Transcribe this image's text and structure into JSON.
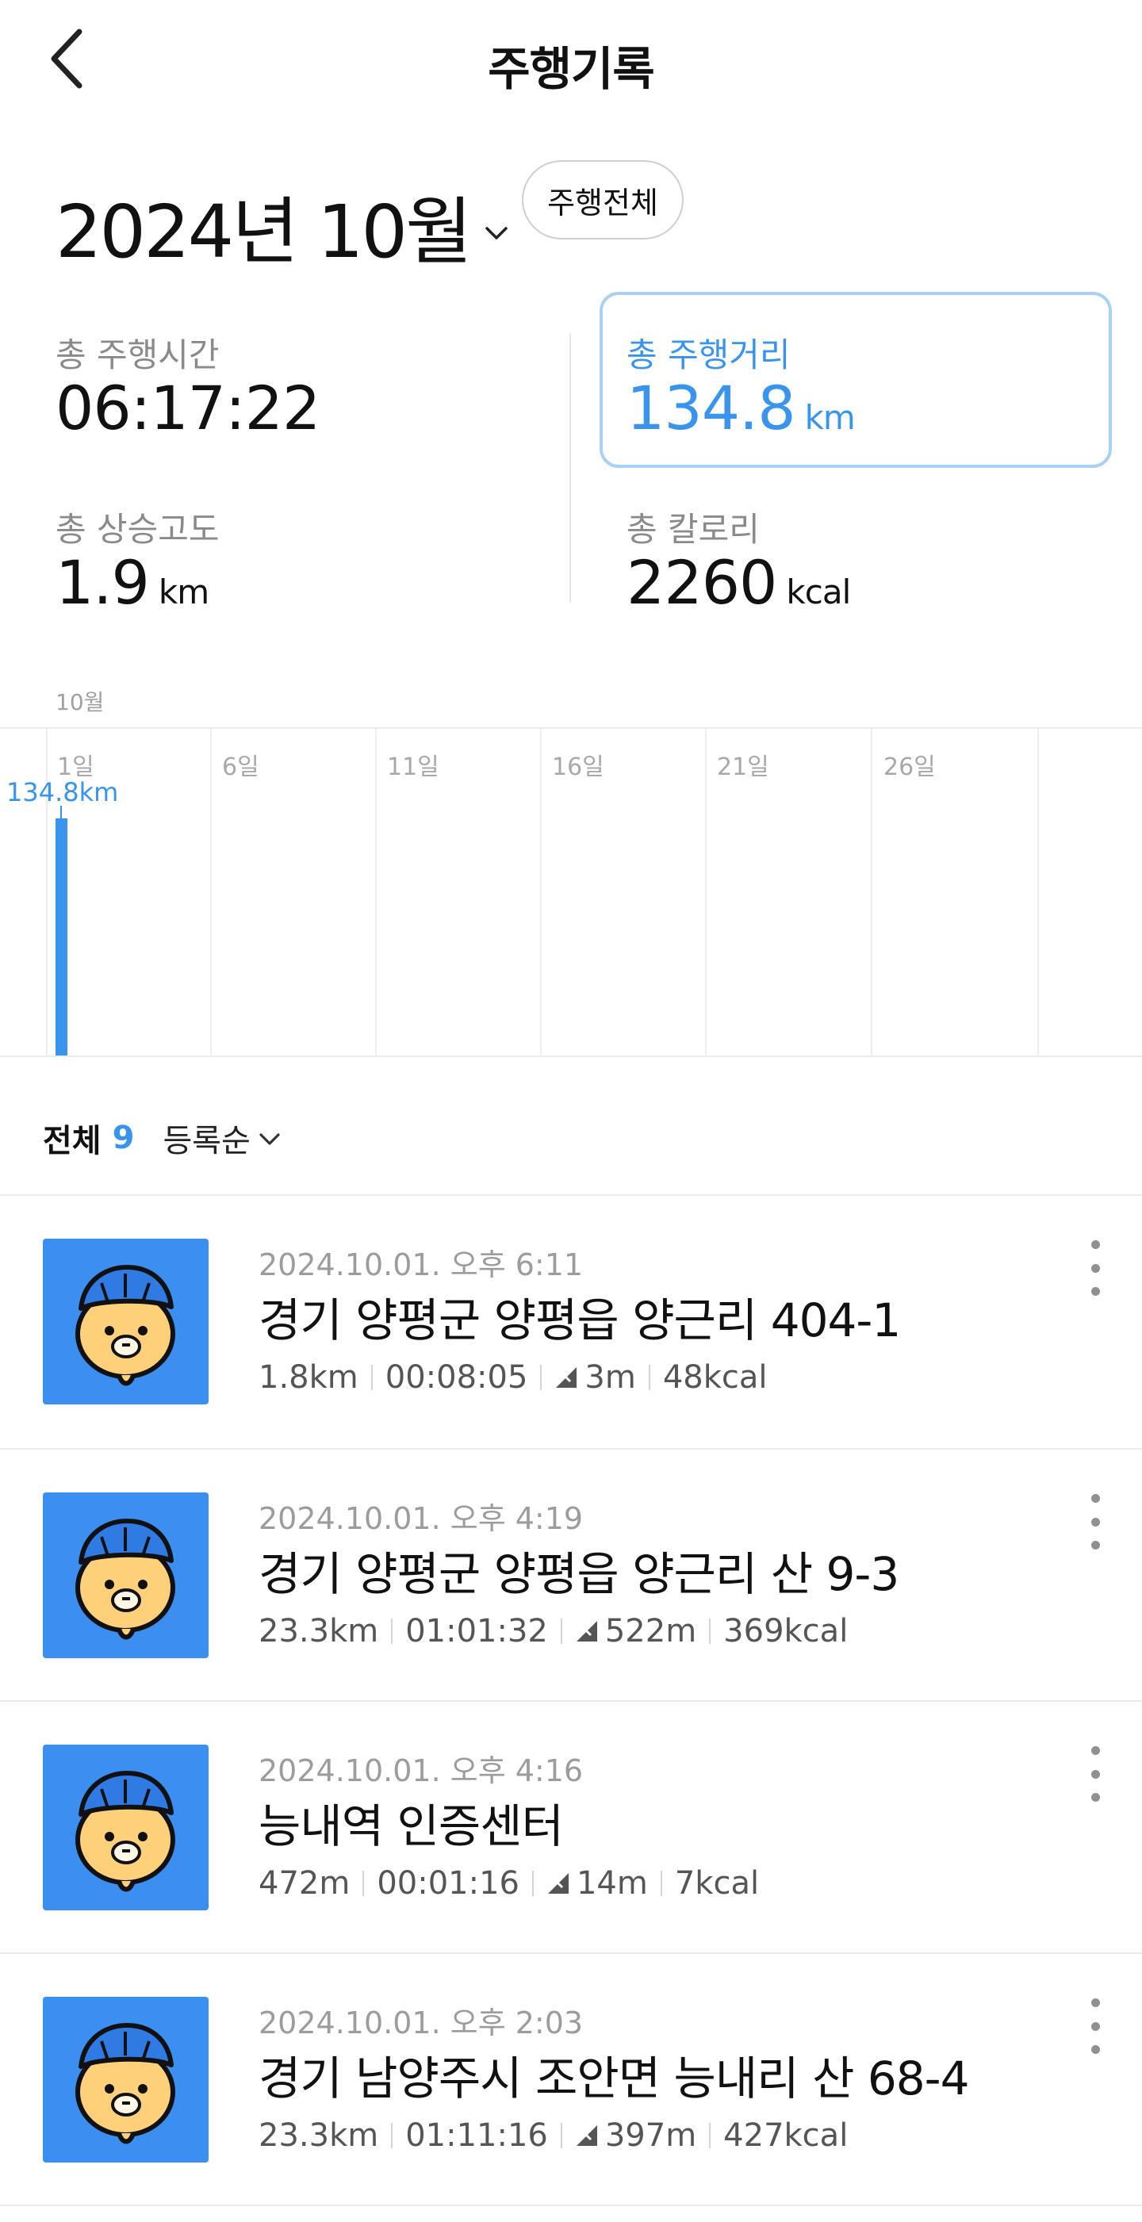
{
  "header": {
    "title": "주행기록",
    "back_icon": "chevron-left-icon"
  },
  "month_selector": {
    "label": "2024년 10월",
    "icon": "chevron-down-icon"
  },
  "filter": {
    "label": "주행전체"
  },
  "stats": {
    "total_time": {
      "label": "총 주행시간",
      "value": "06:17:22"
    },
    "total_distance": {
      "label": "총 주행거리",
      "value": "134.8",
      "unit": "km"
    },
    "total_elevation": {
      "label": "총 상승고도",
      "value": "1.9",
      "unit": "km"
    },
    "total_calories": {
      "label": "총 칼로리",
      "value": "2260",
      "unit": "kcal"
    }
  },
  "chart_data": {
    "type": "bar",
    "month_label": "10월",
    "x_tick_labels": [
      "1일",
      "6일",
      "11일",
      "16일",
      "21일",
      "26일"
    ],
    "categories": [
      "1일"
    ],
    "values": [
      134.8
    ],
    "value_labels": [
      "134.8km"
    ],
    "unit": "km",
    "bar_color": "#3994ee"
  },
  "list": {
    "total_label": "전체",
    "total_count": "9",
    "sort_label": "등록순"
  },
  "rides": [
    {
      "datetime": "2024.10.01. 오후 6:11",
      "place": "경기 양평군 양평읍 양근리 404-1",
      "distance": "1.8km",
      "duration": "00:08:05",
      "elevation": "3m",
      "calories": "48kcal"
    },
    {
      "datetime": "2024.10.01. 오후 4:19",
      "place": "경기 양평군 양평읍 양근리 산 9-3",
      "distance": "23.3km",
      "duration": "01:01:32",
      "elevation": "522m",
      "calories": "369kcal"
    },
    {
      "datetime": "2024.10.01. 오후 4:16",
      "place": "능내역 인증센터",
      "distance": "472m",
      "duration": "00:01:16",
      "elevation": "14m",
      "calories": "7kcal"
    },
    {
      "datetime": "2024.10.01. 오후 2:03",
      "place": "경기 남양주시 조안면 능내리 산 68-4",
      "distance": "23.3km",
      "duration": "01:11:16",
      "elevation": "397m",
      "calories": "427kcal"
    }
  ],
  "colors": {
    "accent": "#3994ee",
    "thumbnail_bg": "#3a8ff1",
    "distance_box_border": "#a9d0f5"
  }
}
